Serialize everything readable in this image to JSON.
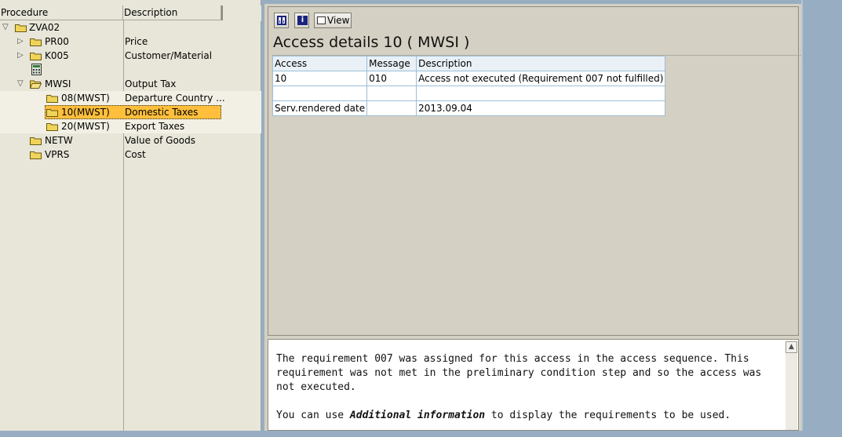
{
  "tree": {
    "columns": {
      "procedure": "Procedure",
      "description": "Description"
    },
    "root": {
      "label": "ZVA02"
    },
    "nodes": [
      {
        "label": "PR00",
        "desc": "Price"
      },
      {
        "label": "K005",
        "desc": "Customer/Material"
      },
      {
        "label": "MWSI",
        "desc": "Output Tax"
      },
      {
        "label": "08(MWST)",
        "desc": "Departure Country ..."
      },
      {
        "label": "10(MWST)",
        "desc": "Domestic Taxes"
      },
      {
        "label": "20(MWST)",
        "desc": "Export Taxes"
      },
      {
        "label": "NETW",
        "desc": "Value of Goods"
      },
      {
        "label": "VPRS",
        "desc": "Cost"
      }
    ],
    "toggles": {
      "expand": "▷",
      "collapse": "▽"
    }
  },
  "toolbar": {
    "icon1": "binoculars-icon",
    "icon2": "info-icon",
    "icon2_glyph": "i",
    "view_label": "View"
  },
  "main": {
    "title": "Access details 10 ( MWSI )",
    "grid": {
      "headers": [
        "Access",
        "Message",
        "Description"
      ],
      "rows": [
        [
          "10",
          "010",
          "Access not executed (Requirement 007 not fulfilled)"
        ],
        [
          "",
          "",
          ""
        ],
        [
          "Serv.rendered date",
          "",
          "2013.09.04"
        ]
      ]
    }
  },
  "info": {
    "para1": "The requirement 007 was assigned for this access in the access sequence. This requirement was not met in the preliminary condition step and so the access was not executed.",
    "para2_before": "You can use ",
    "para2_emph": "Additional information",
    "para2_after": " to display the requirements to be used.",
    "scroll_up": "▲"
  },
  "colors": {
    "selection": "#ffbf3c",
    "grid_border": "#9ebed6",
    "pane_bg": "#d4d0c3"
  }
}
